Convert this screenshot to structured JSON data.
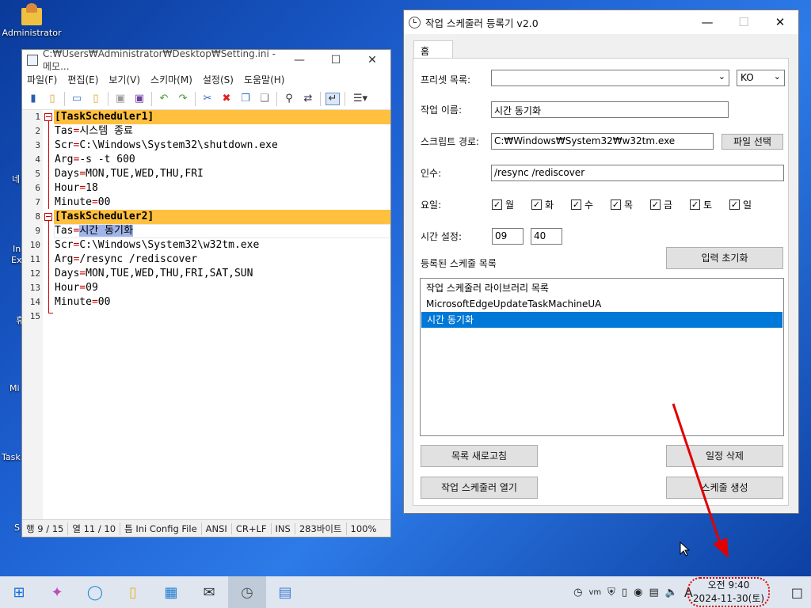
{
  "desktop": {
    "admin_label": "Administrator",
    "edge_labels": [
      "네",
      "In",
      "Ex",
      "휴",
      "Mi",
      "Task",
      "S"
    ]
  },
  "notepad": {
    "title": "C:₩Users₩Administrator₩Desktop₩Setting.ini - 메모...",
    "menu": [
      "파일(F)",
      "편집(E)",
      "보기(V)",
      "스키마(M)",
      "설정(S)",
      "도움말(H)"
    ],
    "lines": [
      {
        "n": "1",
        "key": "[TaskScheduler1]",
        "val": ""
      },
      {
        "n": "2",
        "key": "Tas",
        "val": "시스템 종료"
      },
      {
        "n": "3",
        "key": "Scr",
        "val": "C:\\Windows\\System32\\shutdown.exe"
      },
      {
        "n": "4",
        "key": "Arg",
        "val": "-s -t 600"
      },
      {
        "n": "5",
        "key": "Days",
        "val": "MON,TUE,WED,THU,FRI"
      },
      {
        "n": "6",
        "key": "Hour",
        "val": "18"
      },
      {
        "n": "7",
        "key": "Minute",
        "val": "00"
      },
      {
        "n": "8",
        "key": "[TaskScheduler2]",
        "val": ""
      },
      {
        "n": "9",
        "key": "Tas",
        "val": "시간 동기화"
      },
      {
        "n": "10",
        "key": "Scr",
        "val": "C:\\Windows\\System32\\w32tm.exe"
      },
      {
        "n": "11",
        "key": "Arg",
        "val": "/resync /rediscover"
      },
      {
        "n": "12",
        "key": "Days",
        "val": "MON,TUE,WED,THU,FRI,SAT,SUN"
      },
      {
        "n": "13",
        "key": "Hour",
        "val": "09"
      },
      {
        "n": "14",
        "key": "Minute",
        "val": "00"
      },
      {
        "n": "15",
        "key": "",
        "val": ""
      }
    ],
    "status": {
      "line": "행 9 / 15",
      "col": "열 11 / 10",
      "scheme": "틈 Ini Config File",
      "encoding": "ANSI",
      "eol": "CR+LF",
      "mode": "INS",
      "size": "283바이트",
      "zoom": "100%"
    }
  },
  "scheduler": {
    "title": "작업 스케줄러 등록기 v2.0",
    "tab": "홈",
    "preset_label": "프리셋 목록:",
    "preset_value": "",
    "lang_value": "KO",
    "task_name_label": "작업 이름:",
    "task_name_value": "시간 동기화",
    "script_label": "스크립트 경로:",
    "script_value": "C:₩Windows₩System32₩w32tm.exe",
    "file_button": "파일 선택",
    "args_label": "인수:",
    "args_value": "/resync /rediscover",
    "days_label": "요일:",
    "days": [
      "월",
      "화",
      "수",
      "목",
      "금",
      "토",
      "일"
    ],
    "time_label": "시간 설정:",
    "hour_value": "09",
    "minute_value": "40",
    "registered_label": "등록된 스케줄 목록",
    "reset_button": "입력 초기화",
    "list_items": [
      "작업 스케줄러 라이브러리 목록",
      "MicrosoftEdgeUpdateTaskMachineUA",
      "시간 동기화"
    ],
    "refresh_button": "목록 새로고침",
    "delete_button": "일정 삭제",
    "open_button": "작업 스케줄러 열기",
    "create_button": "스케줄 생성"
  },
  "taskbar": {
    "clock_line1": "오전 9:40",
    "clock_line2": "2024-11-30(토)",
    "ime": "A"
  },
  "colors": {
    "section_highlight": "#ffc040",
    "selection": "#0078d7",
    "annotation": "#e00000"
  }
}
